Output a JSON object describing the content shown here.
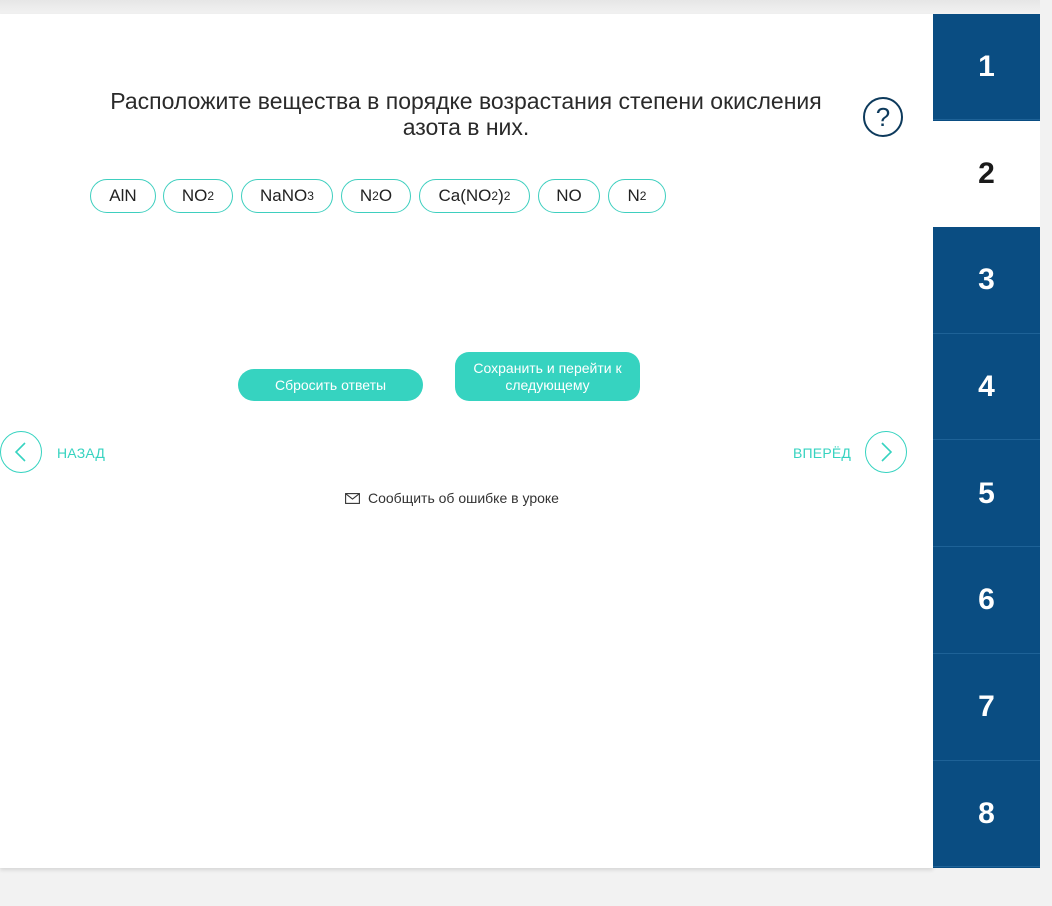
{
  "question": "Расположите вещества в порядке возрастания степени окисления азота в них.",
  "help_label": "?",
  "chips": [
    {
      "parts": [
        {
          "t": "AlN"
        }
      ]
    },
    {
      "parts": [
        {
          "t": "NO"
        },
        {
          "s": "2"
        }
      ]
    },
    {
      "parts": [
        {
          "t": "NaNO"
        },
        {
          "s": "3"
        }
      ]
    },
    {
      "parts": [
        {
          "t": "N"
        },
        {
          "s": "2"
        },
        {
          "t": "O"
        }
      ]
    },
    {
      "parts": [
        {
          "t": "Ca(NO"
        },
        {
          "s": "2"
        },
        {
          "t": ")"
        },
        {
          "s": "2"
        }
      ]
    },
    {
      "parts": [
        {
          "t": "NO"
        }
      ]
    },
    {
      "parts": [
        {
          "t": "N"
        },
        {
          "s": "2"
        }
      ]
    }
  ],
  "buttons": {
    "reset": "Сбросить ответы",
    "save": "Сохранить и перейти к следующему"
  },
  "nav": {
    "back": "НАЗАД",
    "forward": "ВПЕРЁД"
  },
  "report": "Сообщить об ошибке в уроке",
  "steps": [
    "1",
    "2",
    "3",
    "4",
    "5",
    "6",
    "7",
    "8"
  ],
  "active_step": "2",
  "colors": {
    "accent": "#36d3c0",
    "sidebar": "#0a4d82",
    "help": "#0d3a5c"
  }
}
